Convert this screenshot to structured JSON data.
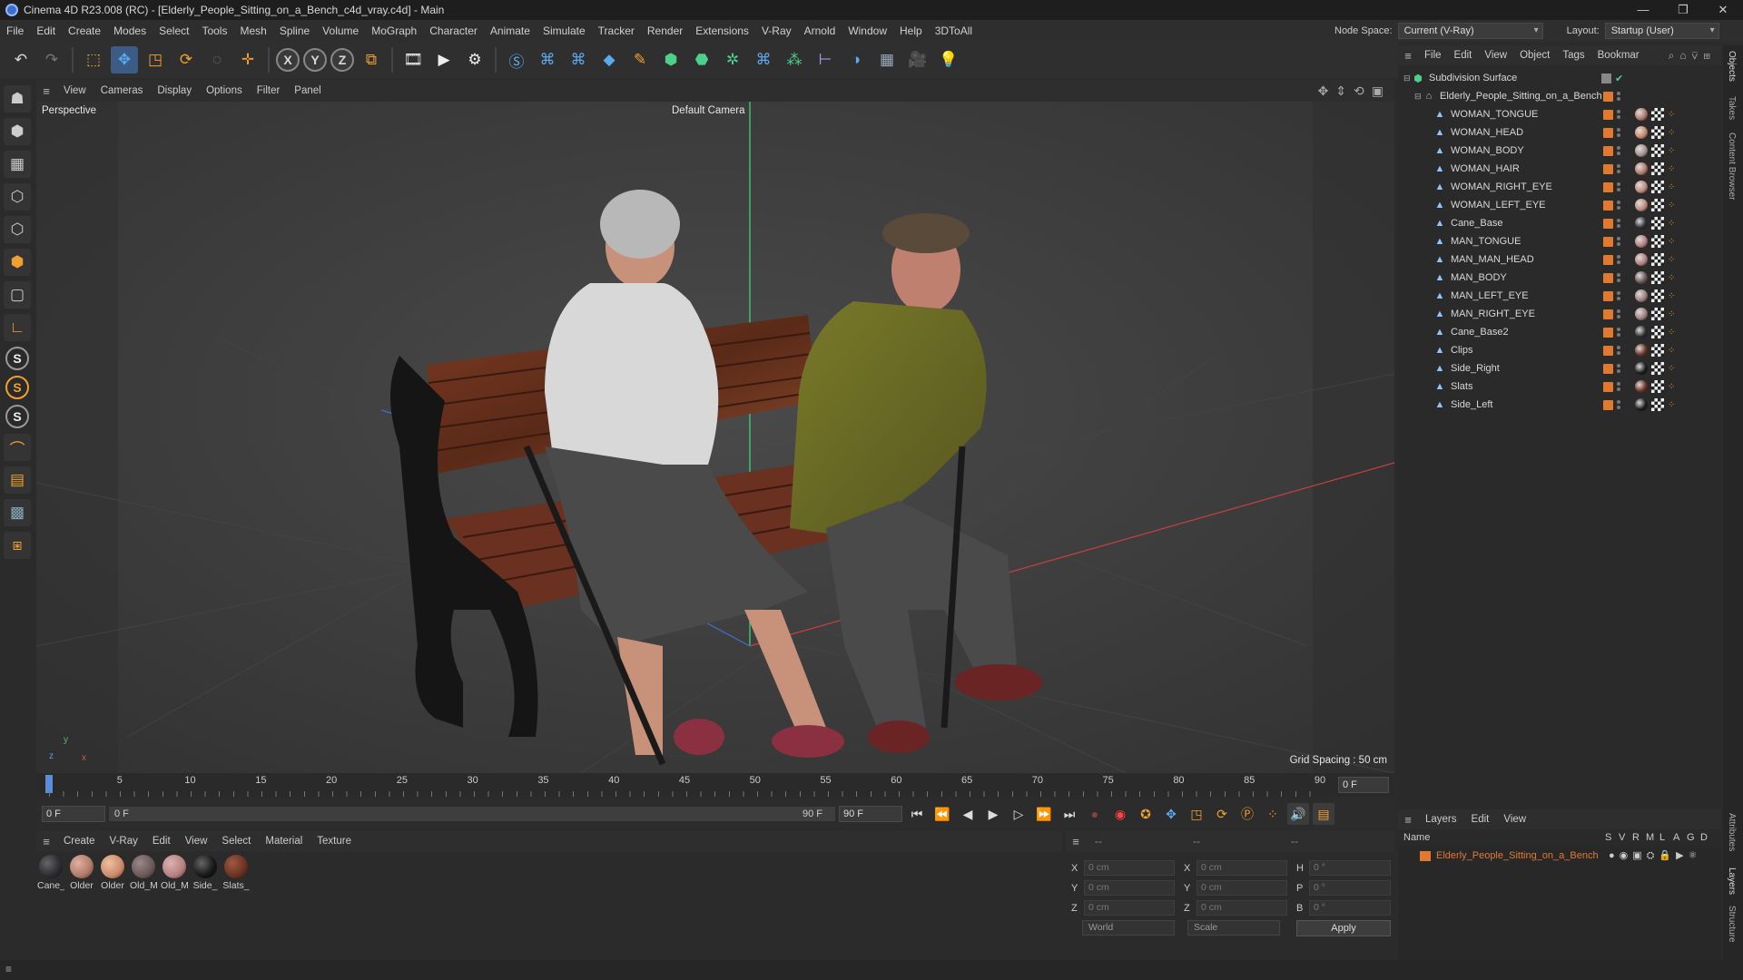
{
  "window": {
    "title": "Cinema 4D R23.008 (RC) - [Elderly_People_Sitting_on_a_Bench_c4d_vray.c4d] - Main",
    "controls": [
      "—",
      "❐",
      "✕"
    ]
  },
  "menubar": {
    "items": [
      "File",
      "Edit",
      "Create",
      "Modes",
      "Select",
      "Tools",
      "Mesh",
      "Spline",
      "Volume",
      "MoGraph",
      "Character",
      "Animate",
      "Simulate",
      "Tracker",
      "Render",
      "Extensions",
      "V-Ray",
      "Arnold",
      "Window",
      "Help",
      "3DToAll"
    ],
    "node_space_label": "Node Space:",
    "node_space_value": "Current (V-Ray)",
    "layout_label": "Layout:",
    "layout_value": "Startup (User)"
  },
  "viewport": {
    "menu": [
      "View",
      "Cameras",
      "Display",
      "Options",
      "Filter",
      "Panel"
    ],
    "name": "Perspective",
    "camera": "Default Camera",
    "grid_spacing": "Grid Spacing : 50 cm"
  },
  "timeline": {
    "ticks": [
      "0",
      "5",
      "10",
      "15",
      "20",
      "25",
      "30",
      "35",
      "40",
      "45",
      "50",
      "55",
      "60",
      "65",
      "70",
      "75",
      "80",
      "85",
      "90"
    ],
    "current_frame": "0 F",
    "start_field": "0 F",
    "range_start": "0 F",
    "range_end": "90 F",
    "end_field": "90 F"
  },
  "materials": {
    "menu": [
      "Create",
      "V-Ray",
      "Edit",
      "View",
      "Select",
      "Material",
      "Texture"
    ],
    "items": [
      {
        "name": "Cane_",
        "color": "#2a2a30"
      },
      {
        "name": "Older",
        "color": "#b07a6a"
      },
      {
        "name": "Older",
        "color": "#c98a6a"
      },
      {
        "name": "Old_M",
        "color": "#6a5858"
      },
      {
        "name": "Old_M",
        "color": "#b48080"
      },
      {
        "name": "Side_",
        "color": "#1a1a1c"
      },
      {
        "name": "Slats_",
        "color": "#6a3222"
      }
    ]
  },
  "coordinates": {
    "header": [
      "--",
      "--",
      "--"
    ],
    "rows": [
      {
        "a": "X",
        "av": "0 cm",
        "b": "X",
        "bv": "0 cm",
        "c": "H",
        "cv": "0 °"
      },
      {
        "a": "Y",
        "av": "0 cm",
        "b": "Y",
        "bv": "0 cm",
        "c": "P",
        "cv": "0 °"
      },
      {
        "a": "Z",
        "av": "0 cm",
        "b": "Z",
        "bv": "0 cm",
        "c": "B",
        "cv": "0 °"
      }
    ],
    "mode": "World",
    "scale": "Scale",
    "apply": "Apply"
  },
  "objects": {
    "menu": [
      "File",
      "Edit",
      "View",
      "Object",
      "Tags",
      "Bookmar"
    ],
    "root": "Subdivision Surface",
    "group": "Elderly_People_Sitting_on_a_Bench",
    "children": [
      {
        "name": "WOMAN_TONGUE",
        "tag": "#b07a6a"
      },
      {
        "name": "WOMAN_HEAD",
        "tag": "#c98a6a"
      },
      {
        "name": "WOMAN_BODY",
        "tag": "#a89090"
      },
      {
        "name": "WOMAN_HAIR",
        "tag": "#b07a6a"
      },
      {
        "name": "WOMAN_RIGHT_EYE",
        "tag": "#c08a7a"
      },
      {
        "name": "WOMAN_LEFT_EYE",
        "tag": "#c08a7a"
      },
      {
        "name": "Cane_Base",
        "tag": "#2a2a30"
      },
      {
        "name": "MAN_TONGUE",
        "tag": "#b48080"
      },
      {
        "name": "MAN_MAN_HEAD",
        "tag": "#b48080"
      },
      {
        "name": "MAN_BODY",
        "tag": "#6a5858"
      },
      {
        "name": "MAN_LEFT_EYE",
        "tag": "#a08080"
      },
      {
        "name": "MAN_RIGHT_EYE",
        "tag": "#a08080"
      },
      {
        "name": "Cane_Base2",
        "tag": "#2a2a30"
      },
      {
        "name": "Clips",
        "tag": "#6a3222"
      },
      {
        "name": "Side_Right",
        "tag": "#1a1a1c"
      },
      {
        "name": "Slats",
        "tag": "#6a3222"
      },
      {
        "name": "Side_Left",
        "tag": "#1a1a1c"
      }
    ]
  },
  "layers": {
    "menu": [
      "Layers",
      "Edit",
      "View"
    ],
    "columns": [
      "Name",
      "S",
      "V",
      "R",
      "M",
      "L",
      "A",
      "G",
      "D"
    ],
    "rows": [
      {
        "name": "Elderly_People_Sitting_on_a_Bench",
        "color": "#e07a30"
      }
    ]
  },
  "side_tabs": [
    "Objects",
    "Takes",
    "Content Browser",
    "Attributes",
    "Layers",
    "Structure"
  ]
}
